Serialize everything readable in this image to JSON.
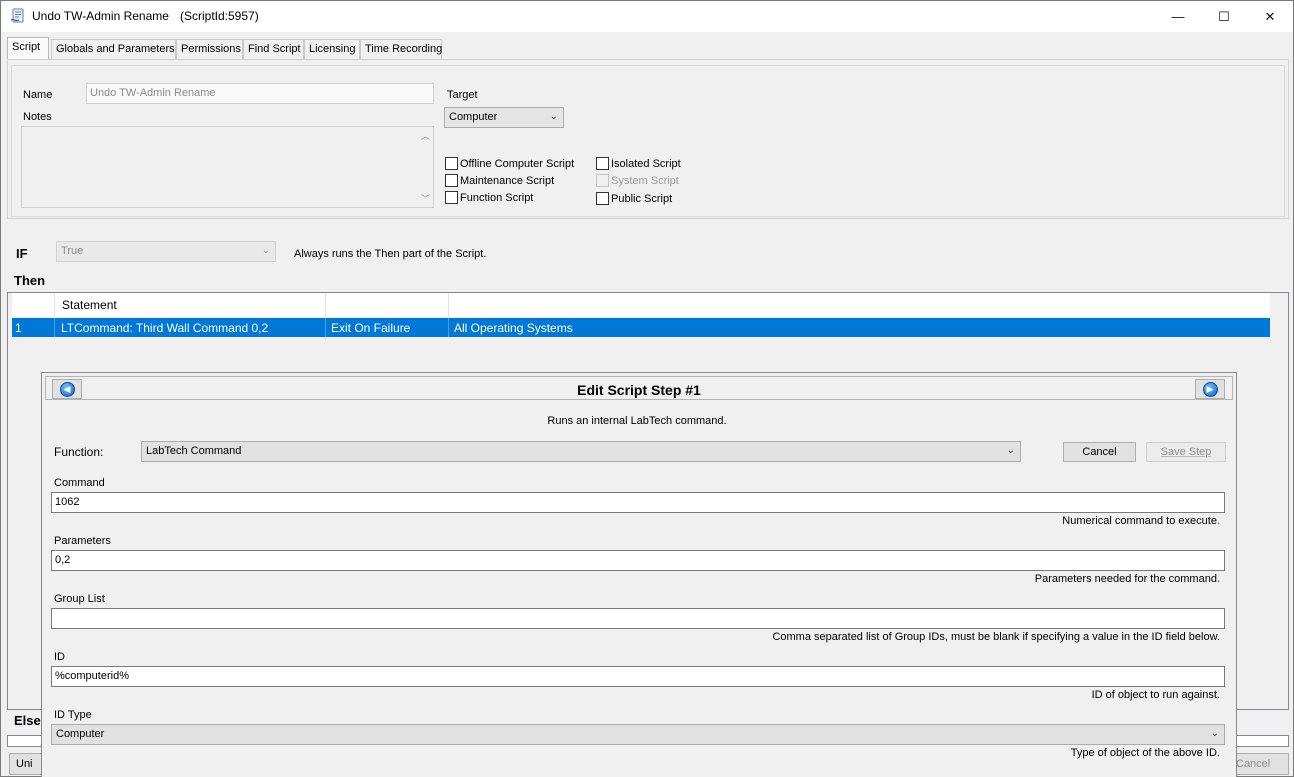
{
  "window": {
    "title": "Undo TW-Admin Rename",
    "script_id": "(ScriptId:5957)",
    "icon": "script-icon",
    "controls": {
      "minimize": "—",
      "maximize": "☐",
      "close": "✕"
    }
  },
  "tabs": [
    {
      "label": "Script"
    },
    {
      "label": "Globals and Parameters"
    },
    {
      "label": "Permissions"
    },
    {
      "label": "Find Script"
    },
    {
      "label": "Licensing"
    },
    {
      "label": "Time Recording"
    }
  ],
  "script_form": {
    "name_label": "Name",
    "name_value": "Undo TW-Admin Rename",
    "notes_label": "Notes",
    "target_label": "Target",
    "target_value": "Computer",
    "checkboxes": {
      "offline": "Offline Computer Script",
      "maintenance": "Maintenance Script",
      "function": "Function Script",
      "isolated": "Isolated Script",
      "system": "System Script",
      "public": "Public Script"
    }
  },
  "if_section": {
    "label": "IF",
    "value": "True",
    "description": "Always runs the Then part of the Script."
  },
  "then_section": {
    "label": "Then",
    "columns": [
      "Statement",
      "",
      ""
    ],
    "rows": [
      {
        "num": "1",
        "statement": "LTCommand: Third Wall Command 0,2",
        "on_failure": "Exit On Failure",
        "os": "All Operating Systems"
      }
    ]
  },
  "else_section": {
    "label": "Else"
  },
  "bottom_buttons": {
    "left": "Uni",
    "right": "Cancel"
  },
  "dialog": {
    "title": "Edit Script Step #1",
    "description": "Runs an internal LabTech command.",
    "function_label": "Function:",
    "function_value": "LabTech Command",
    "cancel_label": "Cancel",
    "save_label": "Save Step",
    "fields": {
      "command": {
        "label": "Command",
        "value": "1062",
        "hint": "Numerical command to execute."
      },
      "parameters": {
        "label": "Parameters",
        "value": "0,2",
        "hint": "Parameters needed for the command."
      },
      "group_list": {
        "label": "Group List",
        "value": "",
        "hint": "Comma separated list of Group IDs, must be blank if specifying a value in the ID field below."
      },
      "id": {
        "label": "ID",
        "value": "%computerid%",
        "hint": "ID of object to run against."
      },
      "id_type": {
        "label": "ID Type",
        "value": "Computer",
        "hint": "Type of object of the above ID."
      }
    }
  }
}
